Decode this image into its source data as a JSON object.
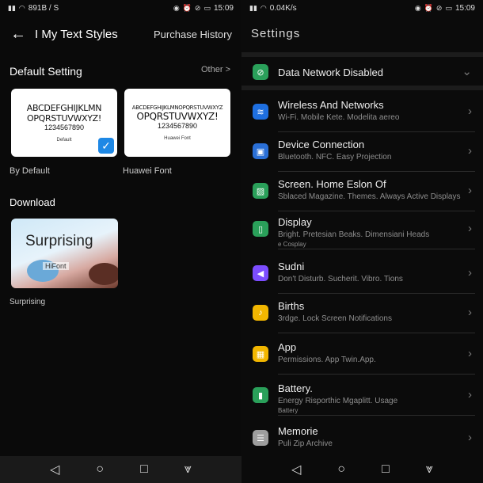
{
  "left": {
    "status": {
      "speed": "891B / S",
      "time": "15:09"
    },
    "title": "I My Text Styles",
    "purchase": "Purchase History",
    "default_section": "Default Setting",
    "other": "Other >",
    "cards": [
      {
        "line1": "ABCDEFGHIJKLMN",
        "line2": "OPQRSTUVWXYZ!",
        "nums": "1234567890",
        "caption": "Default",
        "label": "By Default",
        "checked": true
      },
      {
        "line1": "ABCDEFGHIJKLMNOPQRSTUVWXYZ",
        "line2": "OPQRSTUVWXYZ!",
        "nums": "1234567890",
        "caption": "Huawei Font",
        "label": "Huawei Font",
        "checked": false
      }
    ],
    "download_section": "Download",
    "download_card": {
      "big": "Surprising",
      "sub": "HiFont",
      "label": "Surprising"
    }
  },
  "right": {
    "status": {
      "speed": "0.04K/s",
      "time": "15:09"
    },
    "title": "Settings",
    "network": {
      "label": "Data Network Disabled"
    },
    "items": [
      {
        "title": "Wireless And Networks",
        "sub": "Wi-Fi. Mobile Kete. Modelita aereo",
        "icon": "wifi-icon",
        "color": "#1e6fe0"
      },
      {
        "title": "Device Connection",
        "sub": "Bluetooth. NFC. Easy Projection",
        "icon": "device-icon",
        "color": "#2a6fd6"
      },
      {
        "title": "Screen. Home Eslon Of",
        "sub": "Sblaced Magazine. Themes. Always Active Displays",
        "icon": "image-icon",
        "color": "#2aa05a"
      },
      {
        "title": "Display",
        "sub": "Bright. Pretesian Beaks. Dimensiani Heads",
        "sub2": "e Cosplay",
        "icon": "display-icon",
        "color": "#2aa05a"
      },
      {
        "title": "Sudni",
        "sub": "Don't Disturb. Sucherit. Vibro. Tions",
        "icon": "sound-icon",
        "color": "#7c4dff"
      },
      {
        "title": "Births",
        "sub": "3rdge. Lock Screen Notifications",
        "icon": "bell-icon",
        "color": "#f2b600"
      },
      {
        "title": "App",
        "sub": "Permissions. App Twin.App.",
        "icon": "apps-icon",
        "color": "#f2b600"
      },
      {
        "title": "Battery.",
        "sub": "Energy Risporthic Mgaplitt. Usage",
        "sub2": "Battery",
        "icon": "battery-icon",
        "color": "#2aa05a"
      },
      {
        "title": "Memorie",
        "sub": "Puli Zip Archive",
        "icon": "memory-icon",
        "color": "#9e9e9e"
      }
    ]
  }
}
